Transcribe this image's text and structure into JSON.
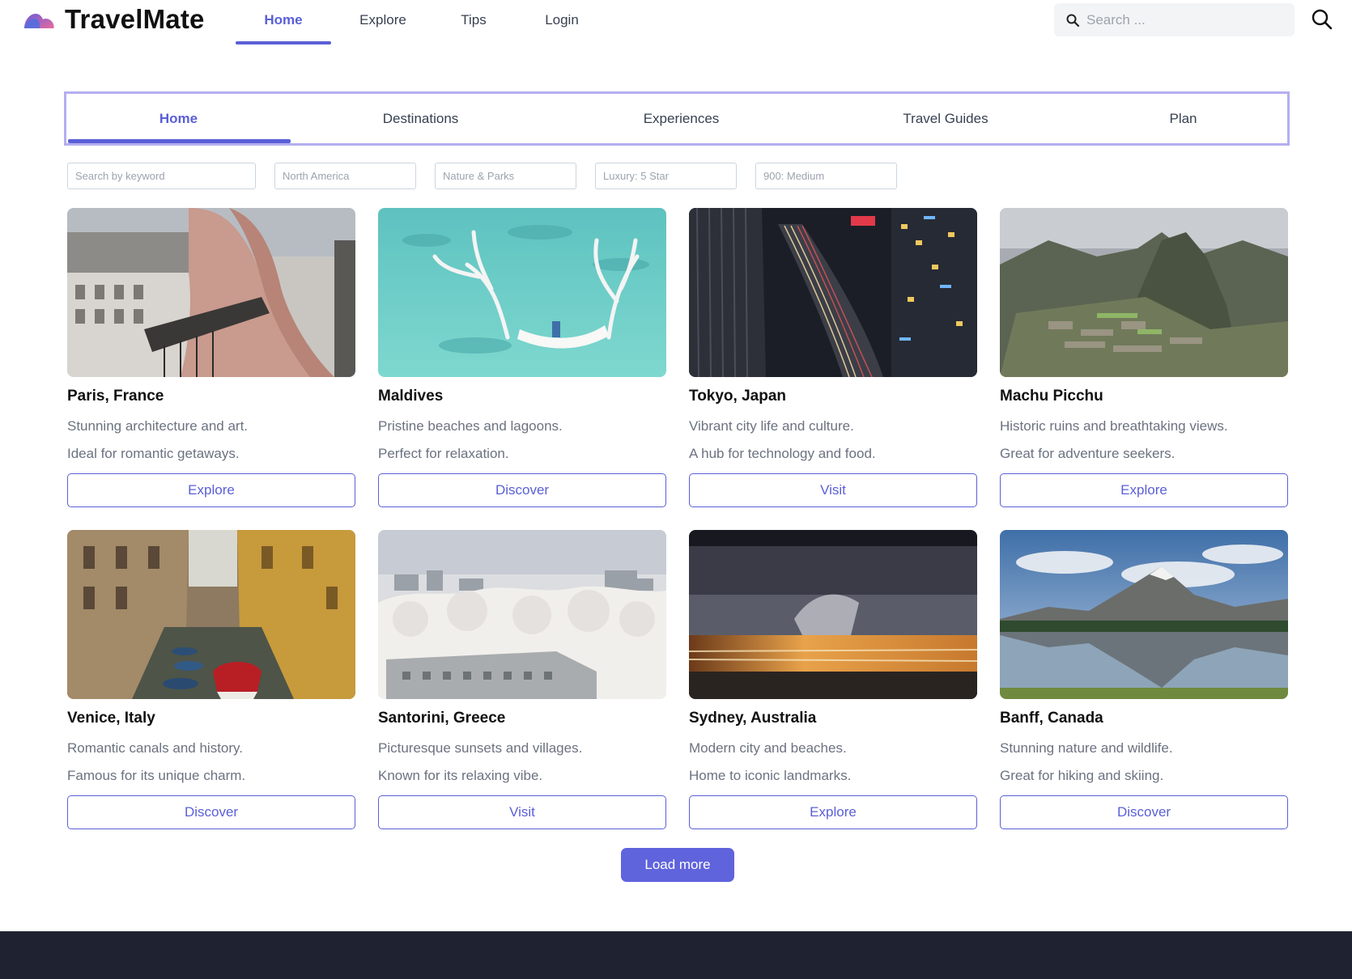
{
  "brand": {
    "name": "TravelMate"
  },
  "nav": {
    "items": [
      {
        "label": "Home",
        "active": true
      },
      {
        "label": "Explore",
        "active": false
      },
      {
        "label": "Tips",
        "active": false
      },
      {
        "label": "Login",
        "active": false
      }
    ]
  },
  "top_search": {
    "placeholder": "Search ..."
  },
  "tabs": [
    {
      "label": "Home",
      "active": true
    },
    {
      "label": "Destinations",
      "active": false
    },
    {
      "label": "Experiences",
      "active": false
    },
    {
      "label": "Travel Guides",
      "active": false
    },
    {
      "label": "Plan",
      "active": false
    }
  ],
  "filters": {
    "keyword": "Search by keyword",
    "region": "North America",
    "category": "Nature & Parks",
    "luxury": "Luxury: 5 Star",
    "budget": "900: Medium"
  },
  "cards": [
    {
      "title": "Paris, France",
      "line1": "Stunning architecture and art.",
      "line2": "Ideal for romantic getaways.",
      "button": "Explore",
      "image": "woman-on-paris-balcony"
    },
    {
      "title": "Maldives",
      "line1": "Pristine beaches and lagoons.",
      "line2": "Perfect for relaxation.",
      "button": "Discover",
      "image": "hammock-in-turquoise-lagoon"
    },
    {
      "title": "Tokyo, Japan",
      "line1": "Vibrant city life and culture.",
      "line2": "A hub for technology and food.",
      "button": "Visit",
      "image": "tokyo-night-highway"
    },
    {
      "title": "Machu Picchu",
      "line1": "Historic ruins and breathtaking views.",
      "line2": "Great for adventure seekers.",
      "button": "Explore",
      "image": "machu-picchu-ruins"
    },
    {
      "title": "Venice, Italy",
      "line1": "Romantic canals and history.",
      "line2": "Famous for its unique charm.",
      "button": "Discover",
      "image": "venice-canal-boats"
    },
    {
      "title": "Santorini, Greece",
      "line1": "Picturesque sunsets and villages.",
      "line2": "Known for its relaxing vibe.",
      "button": "Visit",
      "image": "frosted-trees-city"
    },
    {
      "title": "Sydney, Australia",
      "line1": "Modern city and beaches.",
      "line2": "Home to iconic landmarks.",
      "button": "Explore",
      "image": "long-exposure-train-lights"
    },
    {
      "title": "Banff, Canada",
      "line1": "Stunning nature and wildlife.",
      "line2": "Great for hiking and skiing.",
      "button": "Discover",
      "image": "mountain-lake-reflection"
    }
  ],
  "load_more": {
    "label": "Load more"
  },
  "colors": {
    "accent": "#5a5fd6",
    "tab_border": "#b4aef0",
    "footer": "#1f2230",
    "muted_text": "#6b7280"
  }
}
